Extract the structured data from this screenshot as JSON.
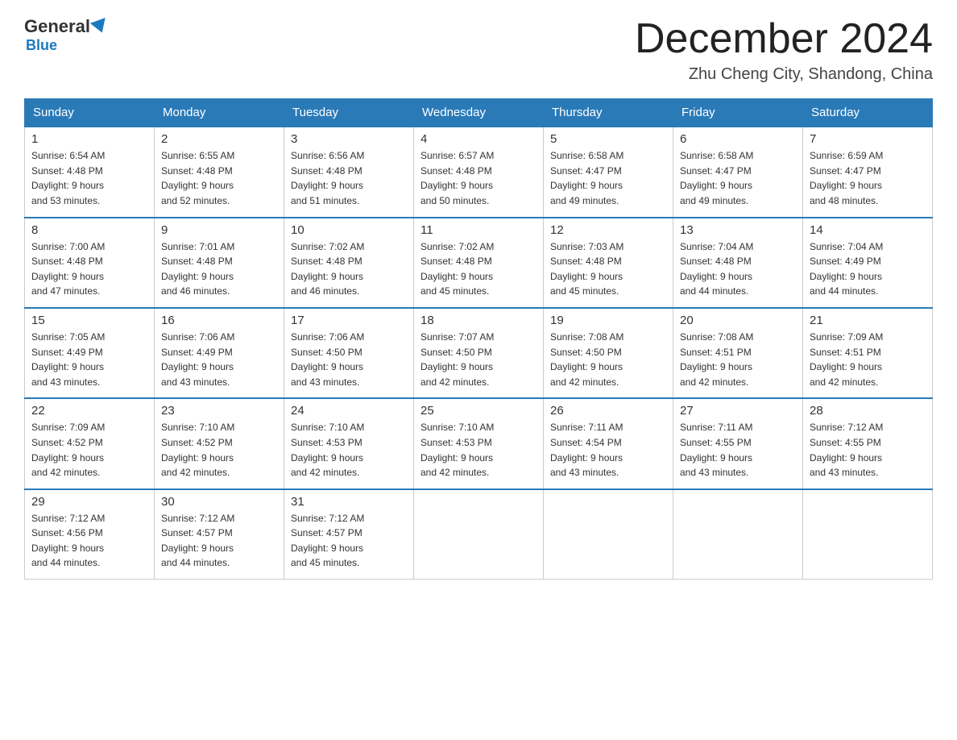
{
  "header": {
    "logo_general": "General",
    "logo_blue": "Blue",
    "month_title": "December 2024",
    "location": "Zhu Cheng City, Shandong, China"
  },
  "weekdays": [
    "Sunday",
    "Monday",
    "Tuesday",
    "Wednesday",
    "Thursday",
    "Friday",
    "Saturday"
  ],
  "weeks": [
    [
      {
        "day": "1",
        "sunrise": "6:54 AM",
        "sunset": "4:48 PM",
        "daylight": "9 hours and 53 minutes."
      },
      {
        "day": "2",
        "sunrise": "6:55 AM",
        "sunset": "4:48 PM",
        "daylight": "9 hours and 52 minutes."
      },
      {
        "day": "3",
        "sunrise": "6:56 AM",
        "sunset": "4:48 PM",
        "daylight": "9 hours and 51 minutes."
      },
      {
        "day": "4",
        "sunrise": "6:57 AM",
        "sunset": "4:48 PM",
        "daylight": "9 hours and 50 minutes."
      },
      {
        "day": "5",
        "sunrise": "6:58 AM",
        "sunset": "4:47 PM",
        "daylight": "9 hours and 49 minutes."
      },
      {
        "day": "6",
        "sunrise": "6:58 AM",
        "sunset": "4:47 PM",
        "daylight": "9 hours and 49 minutes."
      },
      {
        "day": "7",
        "sunrise": "6:59 AM",
        "sunset": "4:47 PM",
        "daylight": "9 hours and 48 minutes."
      }
    ],
    [
      {
        "day": "8",
        "sunrise": "7:00 AM",
        "sunset": "4:48 PM",
        "daylight": "9 hours and 47 minutes."
      },
      {
        "day": "9",
        "sunrise": "7:01 AM",
        "sunset": "4:48 PM",
        "daylight": "9 hours and 46 minutes."
      },
      {
        "day": "10",
        "sunrise": "7:02 AM",
        "sunset": "4:48 PM",
        "daylight": "9 hours and 46 minutes."
      },
      {
        "day": "11",
        "sunrise": "7:02 AM",
        "sunset": "4:48 PM",
        "daylight": "9 hours and 45 minutes."
      },
      {
        "day": "12",
        "sunrise": "7:03 AM",
        "sunset": "4:48 PM",
        "daylight": "9 hours and 45 minutes."
      },
      {
        "day": "13",
        "sunrise": "7:04 AM",
        "sunset": "4:48 PM",
        "daylight": "9 hours and 44 minutes."
      },
      {
        "day": "14",
        "sunrise": "7:04 AM",
        "sunset": "4:49 PM",
        "daylight": "9 hours and 44 minutes."
      }
    ],
    [
      {
        "day": "15",
        "sunrise": "7:05 AM",
        "sunset": "4:49 PM",
        "daylight": "9 hours and 43 minutes."
      },
      {
        "day": "16",
        "sunrise": "7:06 AM",
        "sunset": "4:49 PM",
        "daylight": "9 hours and 43 minutes."
      },
      {
        "day": "17",
        "sunrise": "7:06 AM",
        "sunset": "4:50 PM",
        "daylight": "9 hours and 43 minutes."
      },
      {
        "day": "18",
        "sunrise": "7:07 AM",
        "sunset": "4:50 PM",
        "daylight": "9 hours and 42 minutes."
      },
      {
        "day": "19",
        "sunrise": "7:08 AM",
        "sunset": "4:50 PM",
        "daylight": "9 hours and 42 minutes."
      },
      {
        "day": "20",
        "sunrise": "7:08 AM",
        "sunset": "4:51 PM",
        "daylight": "9 hours and 42 minutes."
      },
      {
        "day": "21",
        "sunrise": "7:09 AM",
        "sunset": "4:51 PM",
        "daylight": "9 hours and 42 minutes."
      }
    ],
    [
      {
        "day": "22",
        "sunrise": "7:09 AM",
        "sunset": "4:52 PM",
        "daylight": "9 hours and 42 minutes."
      },
      {
        "day": "23",
        "sunrise": "7:10 AM",
        "sunset": "4:52 PM",
        "daylight": "9 hours and 42 minutes."
      },
      {
        "day": "24",
        "sunrise": "7:10 AM",
        "sunset": "4:53 PM",
        "daylight": "9 hours and 42 minutes."
      },
      {
        "day": "25",
        "sunrise": "7:10 AM",
        "sunset": "4:53 PM",
        "daylight": "9 hours and 42 minutes."
      },
      {
        "day": "26",
        "sunrise": "7:11 AM",
        "sunset": "4:54 PM",
        "daylight": "9 hours and 43 minutes."
      },
      {
        "day": "27",
        "sunrise": "7:11 AM",
        "sunset": "4:55 PM",
        "daylight": "9 hours and 43 minutes."
      },
      {
        "day": "28",
        "sunrise": "7:12 AM",
        "sunset": "4:55 PM",
        "daylight": "9 hours and 43 minutes."
      }
    ],
    [
      {
        "day": "29",
        "sunrise": "7:12 AM",
        "sunset": "4:56 PM",
        "daylight": "9 hours and 44 minutes."
      },
      {
        "day": "30",
        "sunrise": "7:12 AM",
        "sunset": "4:57 PM",
        "daylight": "9 hours and 44 minutes."
      },
      {
        "day": "31",
        "sunrise": "7:12 AM",
        "sunset": "4:57 PM",
        "daylight": "9 hours and 45 minutes."
      },
      null,
      null,
      null,
      null
    ]
  ],
  "labels": {
    "sunrise": "Sunrise:",
    "sunset": "Sunset:",
    "daylight": "Daylight:"
  }
}
